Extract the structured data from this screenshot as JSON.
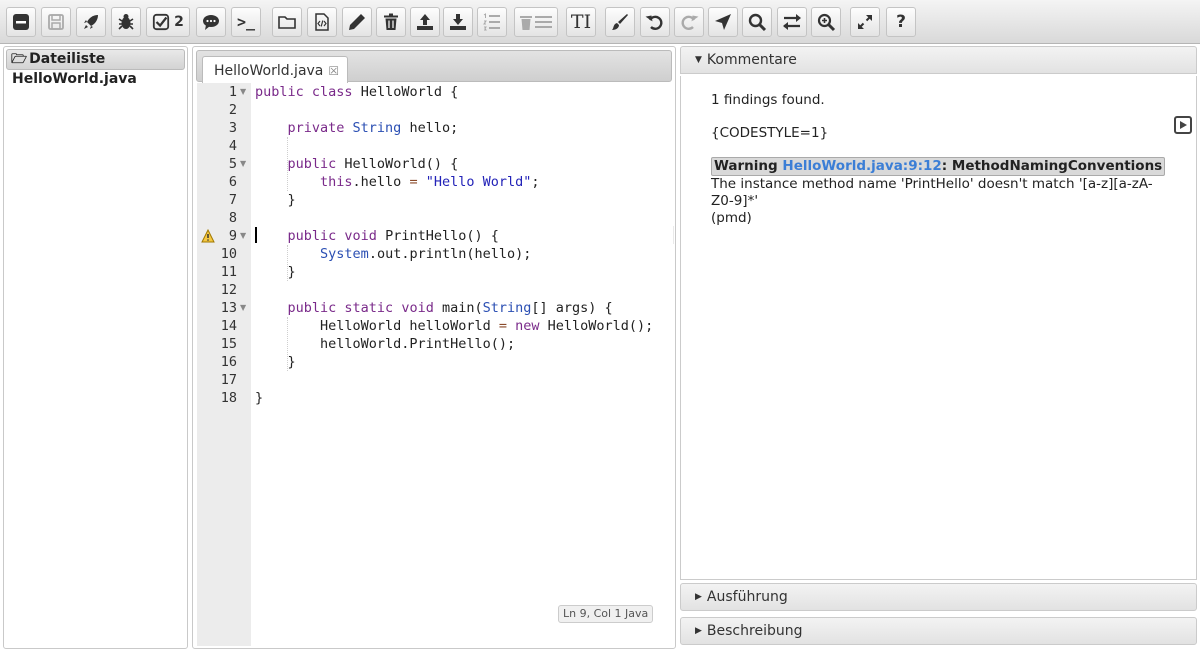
{
  "toolbar": {
    "buttons": [
      {
        "icon": "collapse-icon"
      },
      {
        "icon": "save-icon"
      },
      {
        "icon": "rocket-icon"
      },
      {
        "icon": "bug-icon"
      },
      {
        "icon": "check-icon",
        "count": "2"
      },
      {
        "icon": "comment-icon"
      },
      {
        "icon": "terminal-icon",
        "label": ">_"
      },
      {
        "icon": "folder-icon"
      },
      {
        "icon": "code-file-icon"
      },
      {
        "icon": "pencil-icon"
      },
      {
        "icon": "trash-icon"
      },
      {
        "icon": "upload-icon"
      },
      {
        "icon": "download-icon"
      },
      {
        "icon": "numbered-list-icon"
      },
      {
        "icon": "delete-list-icon"
      },
      {
        "icon": "text-size-icon",
        "label": "TI"
      },
      {
        "icon": "brush-icon"
      },
      {
        "icon": "undo-icon"
      },
      {
        "icon": "redo-icon"
      },
      {
        "icon": "navigate-icon"
      },
      {
        "icon": "search-icon"
      },
      {
        "icon": "swap-icon"
      },
      {
        "icon": "zoom-in-icon"
      },
      {
        "icon": "expand-icon"
      },
      {
        "icon": "help-icon",
        "label": "?"
      }
    ]
  },
  "sidebar": {
    "title": "Dateiliste",
    "files": [
      "HelloWorld.java"
    ]
  },
  "editor": {
    "tab_label": "HelloWorld.java",
    "line_numbers": [
      "1",
      "2",
      "3",
      "4",
      "5",
      "6",
      "7",
      "8",
      "9",
      "10",
      "11",
      "12",
      "13",
      "14",
      "15",
      "16",
      "17",
      "18"
    ],
    "status": "Ln 9, Col 1 Java"
  },
  "comments": {
    "header": "Kommentare",
    "findings": "1 findings found.",
    "codestyle": "{CODESTYLE=1}",
    "warning_label": "Warning",
    "warning_file": "HelloWorld.java:9:12",
    "warning_rule": ": MethodNamingConventions",
    "message_line1": "The instance method name 'PrintHello' doesn't match '[a-z][a-zA-",
    "message_line2": "Z0-9]*'",
    "source": "(pmd)"
  },
  "accordion": {
    "execution": "Ausführung",
    "description": "Beschreibung"
  }
}
